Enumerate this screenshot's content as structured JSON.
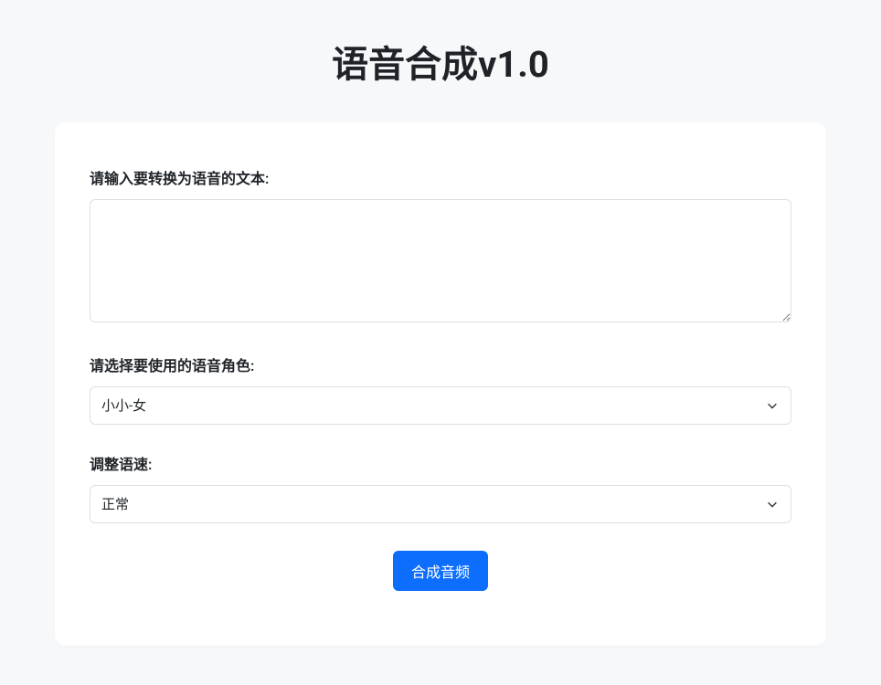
{
  "title": "语音合成v1.0",
  "form": {
    "text": {
      "label": "请输入要转换为语音的文本:",
      "value": ""
    },
    "voice": {
      "label": "请选择要使用的语音角色:",
      "selected": "小小-女"
    },
    "speed": {
      "label": "调整语速:",
      "selected": "正常"
    },
    "submit_label": "合成音频"
  }
}
